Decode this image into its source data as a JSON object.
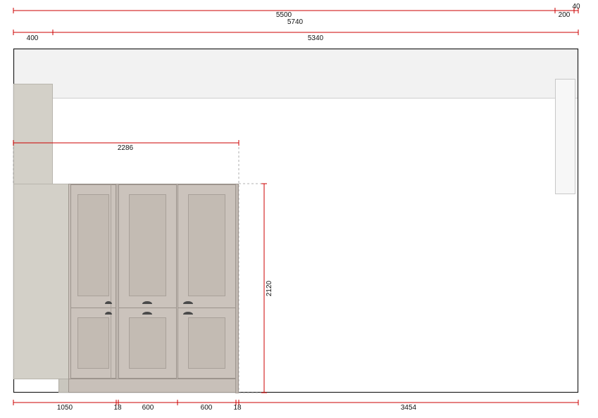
{
  "dimensions": {
    "top_row1": {
      "overall": "5500",
      "right_gap": "200",
      "edge": "40"
    },
    "top_row2": {
      "total": "5740"
    },
    "top_row3": {
      "left": "400",
      "right": "5340"
    },
    "tall_unit_width": "2286",
    "tall_unit_height": "2120",
    "bottom_row": [
      "1050",
      "18",
      "600",
      "600",
      "18",
      "3454"
    ]
  },
  "colors": {
    "dimension_line": "#cc0000",
    "wall_outline": "#222222",
    "ceiling_band": "#f2f2f2",
    "side_panel": "#d3d0c8",
    "door_body": "#cbc3bc",
    "door_inset": "#c2bab2",
    "handle": "#4a4a4a"
  }
}
